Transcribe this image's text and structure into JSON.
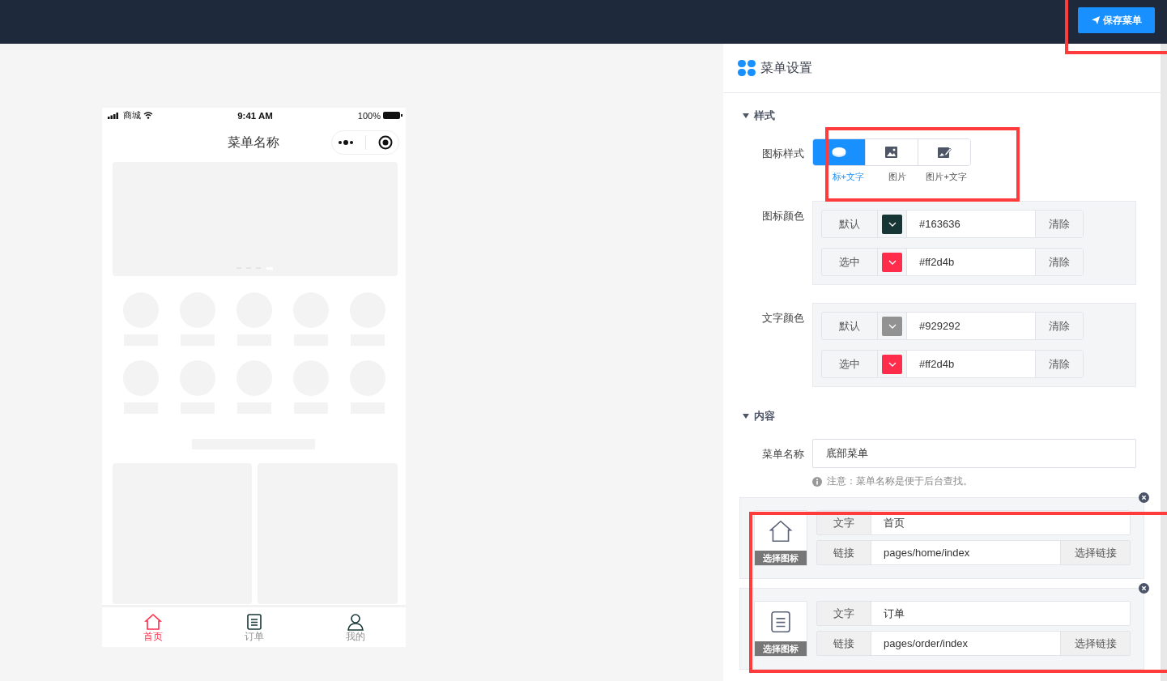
{
  "header": {
    "save_button": "保存菜单"
  },
  "preview": {
    "status_bar": {
      "carrier": "商城",
      "time": "9:41 AM",
      "battery": "100%"
    },
    "title": "菜单名称",
    "tabs": [
      {
        "label": "首页",
        "selected": true
      },
      {
        "label": "订单",
        "selected": false
      },
      {
        "label": "我的",
        "selected": false
      }
    ]
  },
  "panel": {
    "title": "菜单设置",
    "style_section": {
      "title": "样式",
      "expanded": true,
      "icon_style": {
        "label": "图标样式",
        "options": [
          {
            "label": "标+文字",
            "selected": true
          },
          {
            "label": "图片",
            "selected": false
          },
          {
            "label": "图片+文字",
            "selected": false
          }
        ]
      },
      "icon_color": {
        "label": "图标颜色",
        "rows": [
          {
            "label": "默认",
            "color": "#163636",
            "value": "#163636",
            "action": "清除"
          },
          {
            "label": "选中",
            "color": "#ff2d4b",
            "value": "#ff2d4b",
            "action": "清除"
          }
        ]
      },
      "text_color": {
        "label": "文字颜色",
        "rows": [
          {
            "label": "默认",
            "color": "#929292",
            "value": "#929292",
            "action": "清除"
          },
          {
            "label": "选中",
            "color": "#ff2d4b",
            "value": "#ff2d4b",
            "action": "清除"
          }
        ]
      }
    },
    "content_section": {
      "title": "内容",
      "expanded": true,
      "name_field": {
        "label": "菜单名称",
        "value": "底部菜单",
        "note": "注意：菜单名称是便于后台查找。"
      },
      "items": [
        {
          "choose_icon": "选择图标",
          "text_label": "文字",
          "text": "首页",
          "link_label": "链接",
          "link": "pages/home/index",
          "link_button": "选择链接"
        },
        {
          "choose_icon": "选择图标",
          "text_label": "文字",
          "text": "订单",
          "link_label": "链接",
          "link": "pages/order/index",
          "link_button": "选择链接"
        }
      ]
    }
  }
}
